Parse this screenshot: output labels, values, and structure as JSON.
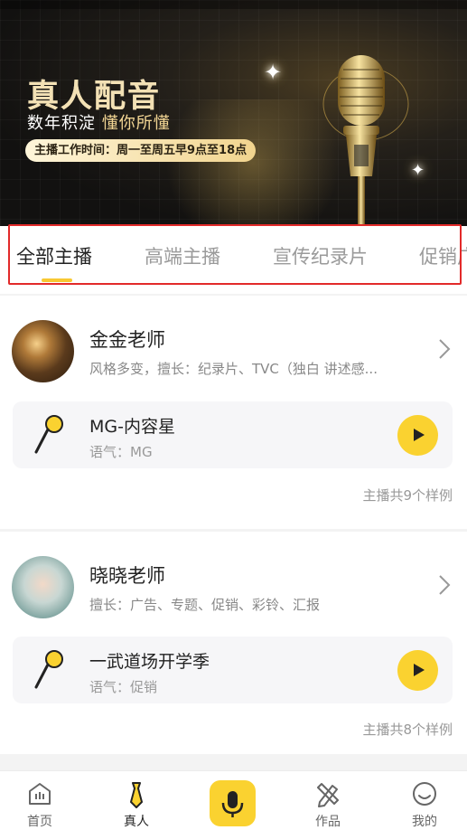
{
  "banner": {
    "title": "真人配音",
    "subtitle_plain": "数年积淀 ",
    "subtitle_highlight": "懂你所懂",
    "hours": "主播工作时间：周一至周五早9点至18点"
  },
  "tabs": [
    {
      "label": "全部主播",
      "active": true
    },
    {
      "label": "高端主播",
      "active": false
    },
    {
      "label": "宣传纪录片",
      "active": false
    },
    {
      "label": "促销广",
      "active": false
    }
  ],
  "hosts": [
    {
      "name": "金金老师",
      "desc": "风格多变，擅长：纪录片、TVC（独白 讲述感...",
      "sample_title": "MG-内容星",
      "sample_tone": "语气：MG",
      "count": "主播共9个样例"
    },
    {
      "name": "晓晓老师",
      "desc": "擅长：广告、专题、促销、彩铃、汇报",
      "sample_title": "一武道场开学季",
      "sample_tone": "语气：促销",
      "count": "主播共8个样例"
    }
  ],
  "nav": [
    {
      "label": "首页",
      "icon": "home-icon",
      "active": false
    },
    {
      "label": "真人",
      "icon": "tie-icon",
      "active": true
    },
    {
      "label": "",
      "icon": "microphone-icon",
      "active": false
    },
    {
      "label": "作品",
      "icon": "pencil-ruler-icon",
      "active": false
    },
    {
      "label": "我的",
      "icon": "smile-face-icon",
      "active": false
    }
  ],
  "colors": {
    "accent": "#fad230",
    "highlight_box": "#e22a2a",
    "banner_gold": "#f1d48e"
  }
}
